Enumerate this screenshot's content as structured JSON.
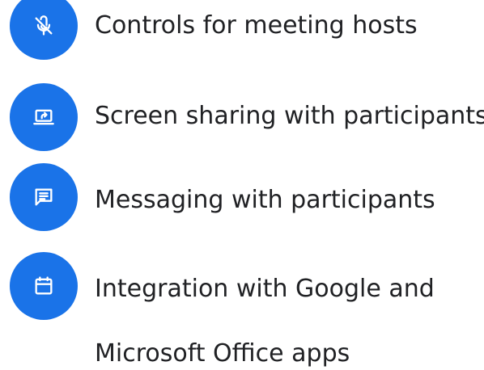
{
  "accent_color": "#1a73e8",
  "text_color": "#202124",
  "features": [
    {
      "icon": "mic-off-icon",
      "label": "Controls for meeting hosts"
    },
    {
      "icon": "screen-share-icon",
      "label": "Screen sharing with participants"
    },
    {
      "icon": "chat-message-icon",
      "label": "Messaging with participants"
    },
    {
      "icon": "calendar-icon",
      "label_line1": "Integration with Google and",
      "label_line2": "Microsoft Office apps"
    }
  ]
}
